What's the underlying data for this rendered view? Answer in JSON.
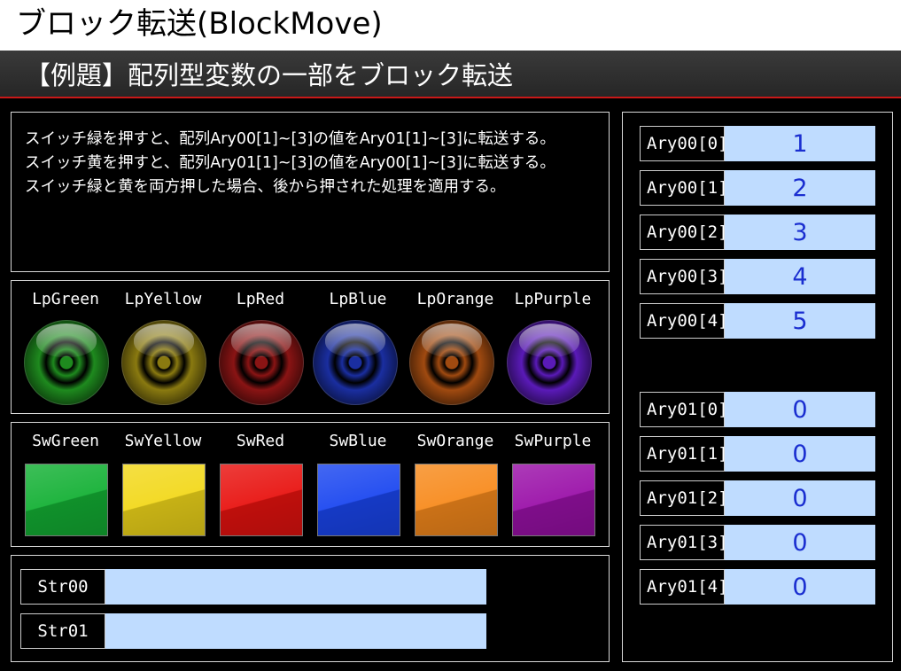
{
  "title": "ブロック転送(BlockMove)",
  "header": "【例題】配列型変数の一部をブロック転送",
  "description": [
    "スイッチ緑を押すと、配列Ary00[1]~[3]の値をAry01[1]~[3]に転送する。",
    "スイッチ黄を押すと、配列Ary01[1]~[3]の値をAry00[1]~[3]に転送する。",
    "スイッチ緑と黄を両方押した場合、後から押された処理を適用する。"
  ],
  "lamps": [
    {
      "label": "LpGreen",
      "color": "#1e8a1e",
      "icon": "lamp-green-icon"
    },
    {
      "label": "LpYellow",
      "color": "#8a7a10",
      "icon": "lamp-yellow-icon"
    },
    {
      "label": "LpRed",
      "color": "#8a1414",
      "icon": "lamp-red-icon"
    },
    {
      "label": "LpBlue",
      "color": "#1a2ea0",
      "icon": "lamp-blue-icon"
    },
    {
      "label": "LpOrange",
      "color": "#a04a10",
      "icon": "lamp-orange-icon"
    },
    {
      "label": "LpPurple",
      "color": "#5a1ab8",
      "icon": "lamp-purple-icon"
    }
  ],
  "switches": [
    {
      "label": "SwGreen",
      "color": "#13b034"
    },
    {
      "label": "SwYellow",
      "color": "#f2d81a"
    },
    {
      "label": "SwRed",
      "color": "#e8120f"
    },
    {
      "label": "SwBlue",
      "color": "#1a46f0"
    },
    {
      "label": "SwOrange",
      "color": "#f78a1c"
    },
    {
      "label": "SwPurple",
      "color": "#9a10a8"
    }
  ],
  "strings": [
    {
      "label": "Str00",
      "value": ""
    },
    {
      "label": "Str01",
      "value": ""
    }
  ],
  "ary00": [
    {
      "label": "Ary00[0]",
      "value": "1"
    },
    {
      "label": "Ary00[1]",
      "value": "2"
    },
    {
      "label": "Ary00[2]",
      "value": "3"
    },
    {
      "label": "Ary00[3]",
      "value": "4"
    },
    {
      "label": "Ary00[4]",
      "value": "5"
    }
  ],
  "ary01": [
    {
      "label": "Ary01[0]",
      "value": "0"
    },
    {
      "label": "Ary01[1]",
      "value": "0"
    },
    {
      "label": "Ary01[2]",
      "value": "0"
    },
    {
      "label": "Ary01[3]",
      "value": "0"
    },
    {
      "label": "Ary01[4]",
      "value": "0"
    }
  ],
  "colors": {
    "value_field": "#bfdcff",
    "value_text": "#1a2ed0",
    "header_line": "#c81818"
  }
}
